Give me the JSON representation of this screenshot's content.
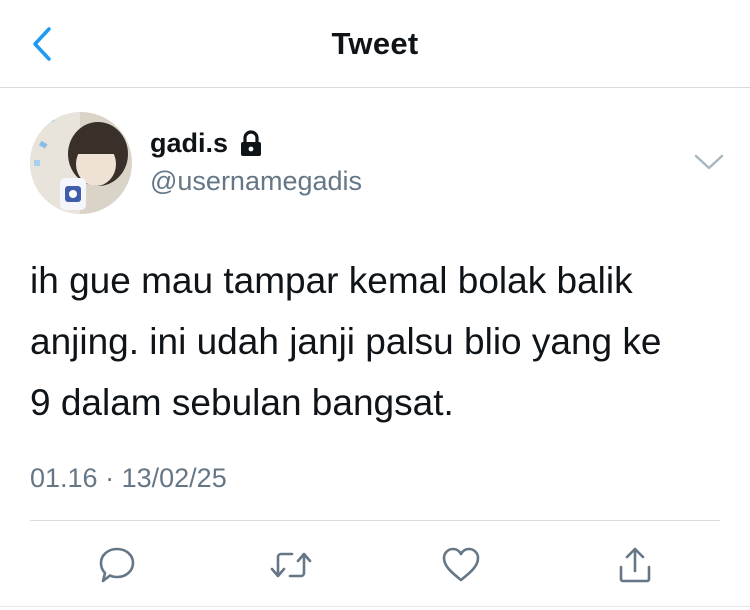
{
  "header": {
    "title": "Tweet",
    "back_icon": "chevron-left-icon",
    "accent_color": "#1d9bf0"
  },
  "author": {
    "display_name": "gadi.s",
    "handle": "@usernamegadis",
    "protected_icon": "lock-icon"
  },
  "tweet": {
    "lines": [
      "ih gue mau tampar kemal bolak balik",
      "anjing. ini udah janji palsu blio yang ke",
      "9 dalam sebulan bangsat."
    ],
    "time": "01.16",
    "separator": "·",
    "date": "13/02/25"
  },
  "actions": [
    {
      "name": "reply",
      "icon": "comment-icon"
    },
    {
      "name": "retweet",
      "icon": "retweet-icon"
    },
    {
      "name": "like",
      "icon": "heart-icon"
    },
    {
      "name": "share",
      "icon": "share-icon"
    }
  ]
}
